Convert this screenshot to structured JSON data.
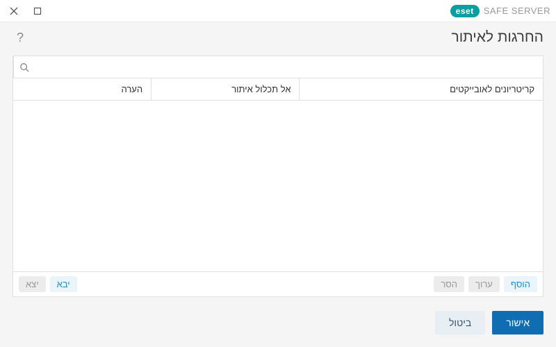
{
  "brand": {
    "badge": "eset",
    "product": "SAFE SERVER"
  },
  "page_title": "החרגות לאיתור",
  "columns": {
    "criteria": "קריטריונים לאובייקטים",
    "exclude": "אל תכלול איתור",
    "comment": "הערה"
  },
  "search": {
    "placeholder": ""
  },
  "actions": {
    "add": "הוסף",
    "edit": "ערוך",
    "remove": "הסר",
    "import": "יבא",
    "export": "יצא"
  },
  "footer": {
    "ok": "אישור",
    "cancel": "ביטול"
  },
  "help_tooltip": "?",
  "rows": []
}
